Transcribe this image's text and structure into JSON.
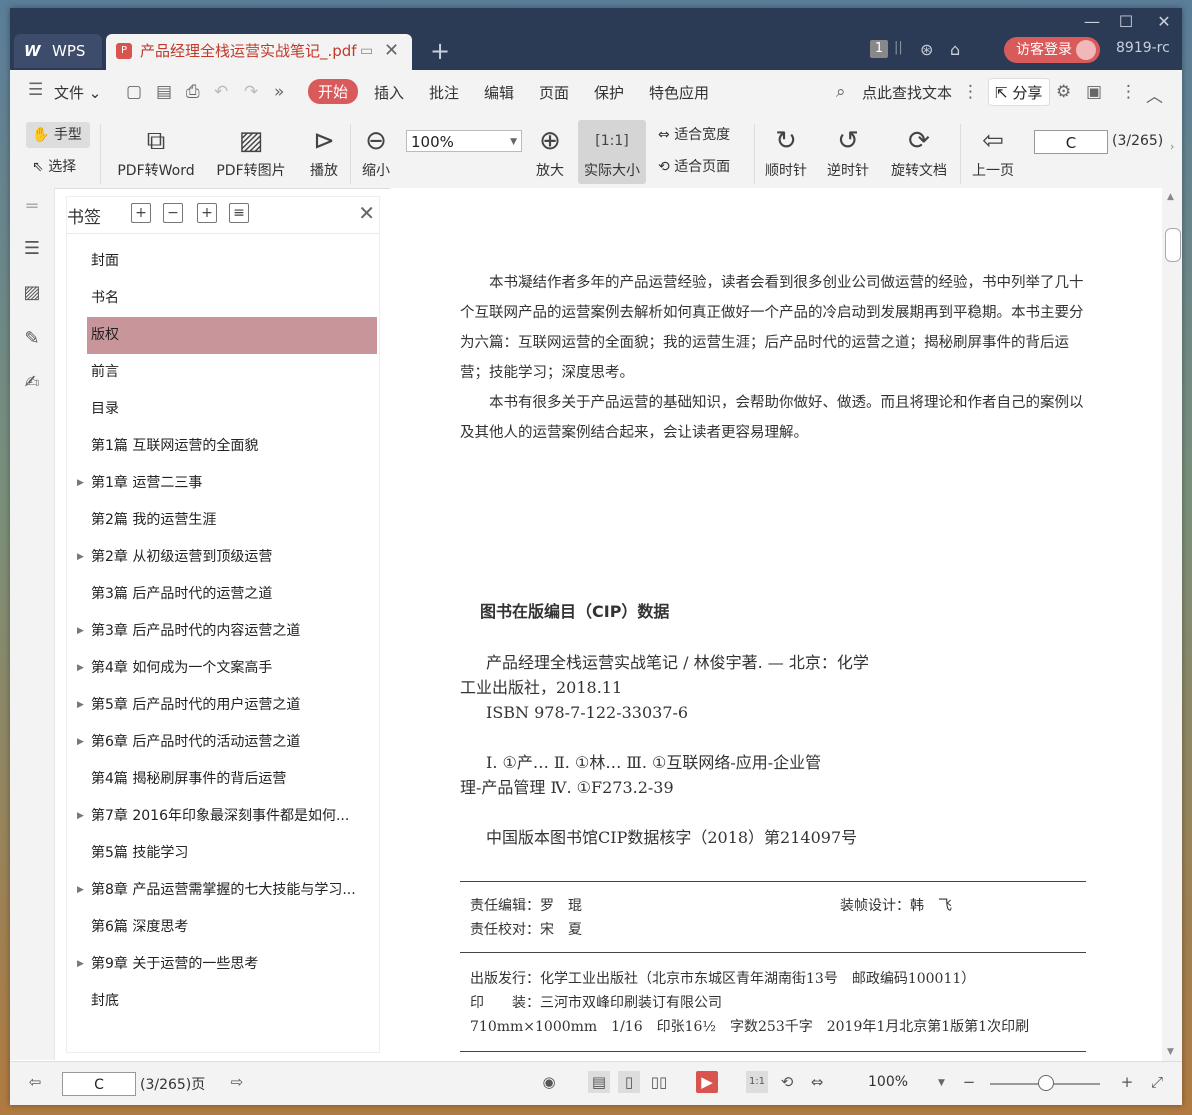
{
  "window": {
    "app_tab": "WPS",
    "doc_tab": "产品经理全栈运营实战笔记_.pdf",
    "page_badge": "1",
    "login": "访客登录",
    "user_id": "8919-rc"
  },
  "menu": {
    "file": "文件",
    "tabs": [
      "开始",
      "插入",
      "批注",
      "编辑",
      "页面",
      "保护",
      "特色应用"
    ],
    "search": "点此查找文本",
    "share": "分享"
  },
  "toolbar": {
    "hand": "手型",
    "select": "选择",
    "pdf_to_word": "PDF转Word",
    "pdf_to_image": "PDF转图片",
    "play": "播放",
    "zoom_out": "缩小",
    "zoom_value": "100%",
    "zoom_in": "放大",
    "actual_size": "实际大小",
    "fit_width": "适合宽度",
    "fit_page": "适合页面",
    "clockwise": "顺时针",
    "counter_clockwise": "逆时针",
    "rotate_doc": "旋转文档",
    "prev_page": "上一页",
    "page_input": "C",
    "page_total": "(3/265)"
  },
  "bookmarks": {
    "title": "书签",
    "items": [
      {
        "label": "封面",
        "expandable": false
      },
      {
        "label": "书名",
        "expandable": false
      },
      {
        "label": "版权",
        "expandable": false,
        "selected": true
      },
      {
        "label": "前言",
        "expandable": false
      },
      {
        "label": "目录",
        "expandable": false
      },
      {
        "label": "第1篇  互联网运营的全面貌",
        "expandable": false
      },
      {
        "label": "第1章  运营二三事",
        "expandable": true
      },
      {
        "label": "第2篇  我的运营生涯",
        "expandable": false
      },
      {
        "label": "第2章  从初级运营到顶级运营",
        "expandable": true
      },
      {
        "label": "第3篇  后产品时代的运营之道",
        "expandable": false
      },
      {
        "label": "第3章  后产品时代的内容运营之道",
        "expandable": true
      },
      {
        "label": "第4章  如何成为一个文案高手",
        "expandable": true
      },
      {
        "label": "第5章  后产品时代的用户运营之道",
        "expandable": true
      },
      {
        "label": "第6章  后产品时代的活动运营之道",
        "expandable": true
      },
      {
        "label": "第4篇  揭秘刷屏事件的背后运营",
        "expandable": false
      },
      {
        "label": "第7章  2016年印象最深刻事件都是如何...",
        "expandable": true
      },
      {
        "label": "第5篇  技能学习",
        "expandable": false
      },
      {
        "label": "第8章  产品运营需掌握的七大技能与学习...",
        "expandable": true
      },
      {
        "label": "第6篇  深度思考",
        "expandable": false
      },
      {
        "label": "第9章  关于运营的一些思考",
        "expandable": true
      },
      {
        "label": "封底",
        "expandable": false
      }
    ]
  },
  "page": {
    "intro1": "本书凝结作者多年的产品运营经验，读者会看到很多创业公司做运营的经验，书中列举了几十个互联网产品的运营案例去解析如何真正做好一个产品的冷启动到发展期再到平稳期。本书主要分为六篇：互联网运营的全面貌；我的运营生涯；后产品时代的运营之道；揭秘刷屏事件的背后运营；技能学习；深度思考。",
    "intro2": "本书有很多关于产品运营的基础知识，会帮助你做好、做透。而且将理论和作者自己的案例以及其他人的运营案例结合起来，会让读者更容易理解。",
    "cip_title": "图书在版编目（CIP）数据",
    "cip_line1": "产品经理全栈运营实战笔记 / 林俊宇著. — 北京：化学",
    "cip_line1b": "工业出版社，2018.11",
    "cip_isbn": "ISBN 978-7-122-33037-6",
    "cip_class1": "Ⅰ. ①产…  Ⅱ. ①林…  Ⅲ. ①互联网络-应用-企业管",
    "cip_class2": "理-产品管理  Ⅳ. ①F273.2-39",
    "cip_no": "中国版本图书馆CIP数据核字（2018）第214097号",
    "editor": "责任编辑：罗　琨",
    "designer": "装帧设计：韩　飞",
    "proofreader": "责任校对：宋　夏",
    "publisher": "出版发行：化学工业出版社（北京市东城区青年湖南街13号　邮政编码100011）",
    "printer": "印　　装：三河市双峰印刷装订有限公司",
    "specs": "710mm×1000mm　1/16　印张16½　字数253千字　2019年1月北京第1版第1次印刷"
  },
  "status": {
    "page_input": "C",
    "page_info": "(3/265)页",
    "zoom": "100%"
  },
  "colors": {
    "titlebar": "#2b3a55",
    "accent": "#d95a5a",
    "bookmark_selected": "#c8969a"
  }
}
